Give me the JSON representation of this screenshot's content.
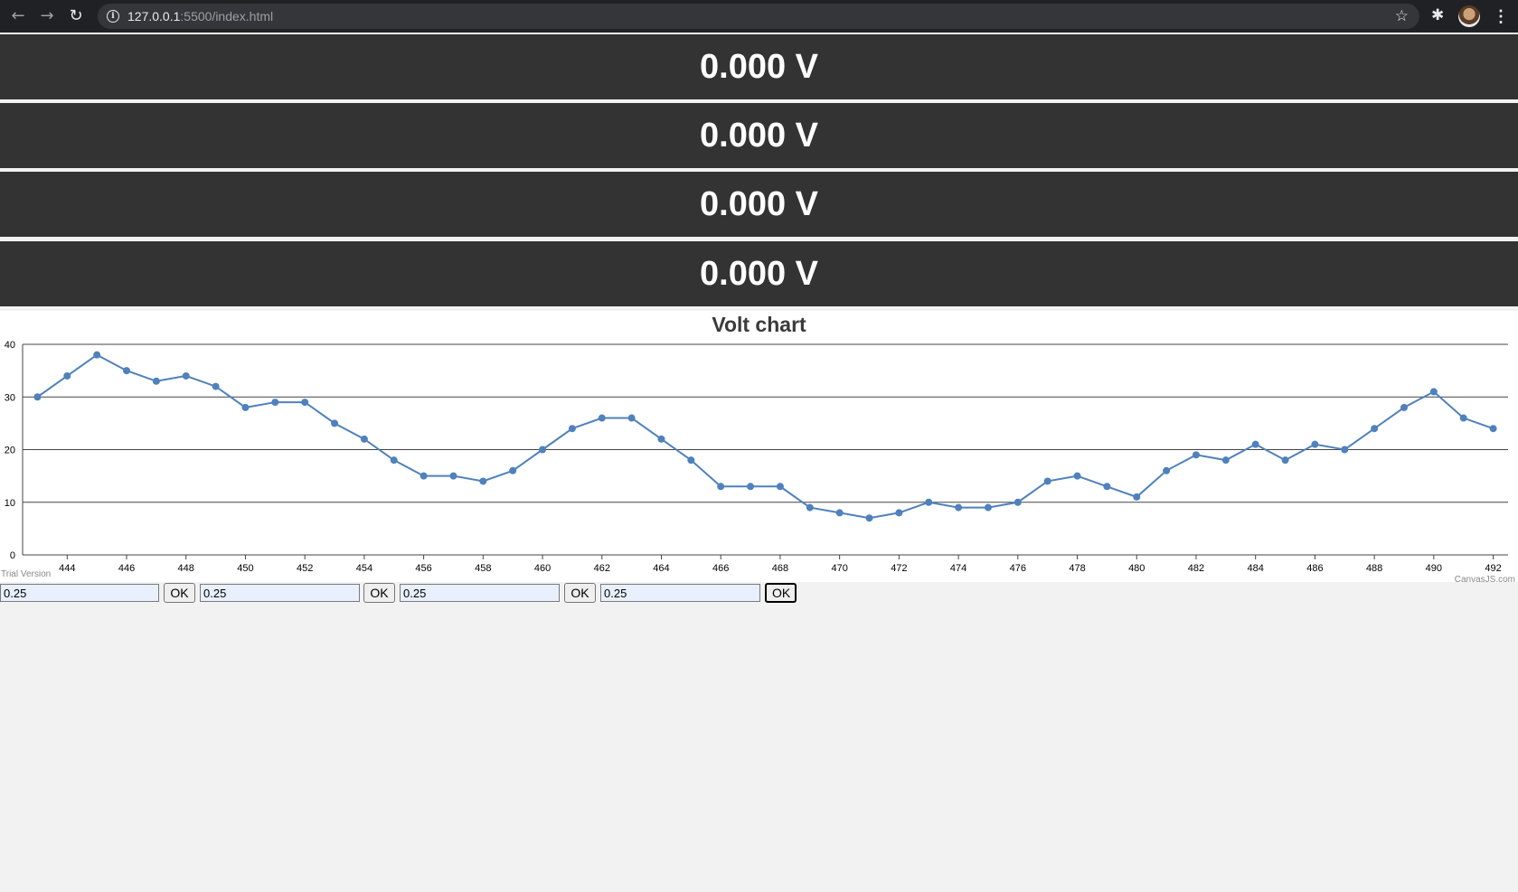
{
  "browser": {
    "back_icon": "arrow-left-icon",
    "forward_icon": "arrow-right-icon",
    "reload_icon": "reload-icon",
    "url_host": "127.0.0.1",
    "url_rest": ":5500/index.html"
  },
  "readings": [
    {
      "value": "0.000 V"
    },
    {
      "value": "0.000 V"
    },
    {
      "value": "0.000 V"
    },
    {
      "value": "0.000 V"
    }
  ],
  "chart": {
    "title": "Volt chart",
    "watermark_left": "Trial Version",
    "watermark_right": "CanvasJS.com"
  },
  "chart_data": {
    "type": "line",
    "title": "Volt chart",
    "xlabel": "",
    "ylabel": "",
    "xlim": [
      442.5,
      492.5
    ],
    "ylim": [
      0,
      40
    ],
    "x_ticks": [
      444,
      446,
      448,
      450,
      452,
      454,
      456,
      458,
      460,
      462,
      464,
      466,
      468,
      470,
      472,
      474,
      476,
      478,
      480,
      482,
      484,
      486,
      488,
      490,
      492
    ],
    "y_ticks": [
      0,
      10,
      20,
      30,
      40
    ],
    "grid": "horizontal",
    "line_color": "#4f81bc",
    "series": [
      {
        "x": [
          443,
          444,
          445,
          446,
          447,
          448,
          449,
          450,
          451,
          452,
          453,
          454,
          455,
          456,
          457,
          458,
          459,
          460,
          461,
          462,
          463,
          464,
          465,
          466,
          467,
          468,
          469,
          470,
          471,
          472,
          473,
          474,
          475,
          476,
          477,
          478,
          479,
          480,
          481,
          482,
          483,
          484,
          485,
          486,
          487,
          488,
          489,
          490,
          491,
          492
        ],
        "values": [
          30,
          34,
          38,
          35,
          33,
          34,
          32,
          28,
          29,
          29,
          25,
          22,
          18,
          15,
          15,
          14,
          16,
          20,
          24,
          26,
          26,
          22,
          18,
          13,
          13,
          13,
          9,
          8,
          7,
          8,
          10,
          9,
          9,
          10,
          14,
          15,
          13,
          11,
          16,
          19,
          18,
          21,
          18,
          21,
          20,
          24,
          28,
          31,
          26,
          24
        ]
      }
    ]
  },
  "controls": [
    {
      "value": "0.25",
      "button": "OK"
    },
    {
      "value": "0.25",
      "button": "OK"
    },
    {
      "value": "0.25",
      "button": "OK"
    },
    {
      "value": "0.25",
      "button": "OK"
    }
  ]
}
